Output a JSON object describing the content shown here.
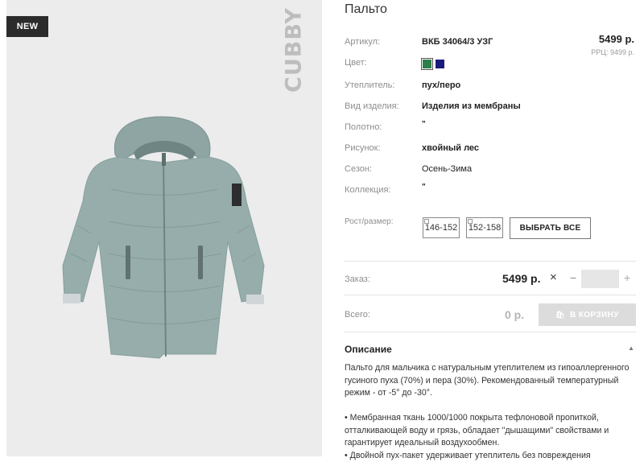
{
  "image": {
    "badge": "NEW",
    "brand_vertical": "CUBBY"
  },
  "product": {
    "title": "Пальто",
    "price": "5499 р.",
    "rrp": "РРЦ: 9499 р.",
    "attributes": [
      {
        "label": "Артикул:",
        "value": "ВКБ 34064/3 УЗГ"
      },
      {
        "label": "Цвет:",
        "value": ""
      },
      {
        "label": "Утеплитель:",
        "value": "пух/перо"
      },
      {
        "label": "Вид изделия:",
        "value": "Изделия из мембраны"
      },
      {
        "label": "Полотно:",
        "value": "\""
      },
      {
        "label": "Рисунок:",
        "value": "хвойный лес"
      },
      {
        "label": "Сезон:",
        "value": "Осень-Зима"
      },
      {
        "label": "Коллекция:",
        "value": "\""
      }
    ],
    "colors": [
      "#2f7d4b",
      "#1a1a7a"
    ],
    "size_label": "Рост/размер:",
    "sizes": [
      "146-152",
      "152-158"
    ],
    "select_all": "ВЫБРАТЬ ВСЕ"
  },
  "order": {
    "label": "Заказ:",
    "price": "5499 р.",
    "times": "×",
    "minus": "−",
    "plus": "+",
    "qty_value": ""
  },
  "total": {
    "label": "Всего:",
    "value": "0 р.",
    "cart_button": "В КОРЗИНУ",
    "cart_icon": "shopping-bag-icon"
  },
  "description": {
    "heading": "Описание",
    "paragraphs": [
      "Пальто для мальчика с натуральным утеплителем из гипоаллергенного гусиного пуха (70%) и пера (30%). Рекомендованный температурный режим - от -5° до -30°.",
      "• Мембранная ткань 1000/1000 покрыта тефлоновой пропиткой, отталкивающей воду и грязь, обладает \"дышащими\" свойствами и гарантирует идеальный воздухообмен.",
      "• Двойной пух-пакет удерживает утеплитель без повреждения"
    ]
  }
}
